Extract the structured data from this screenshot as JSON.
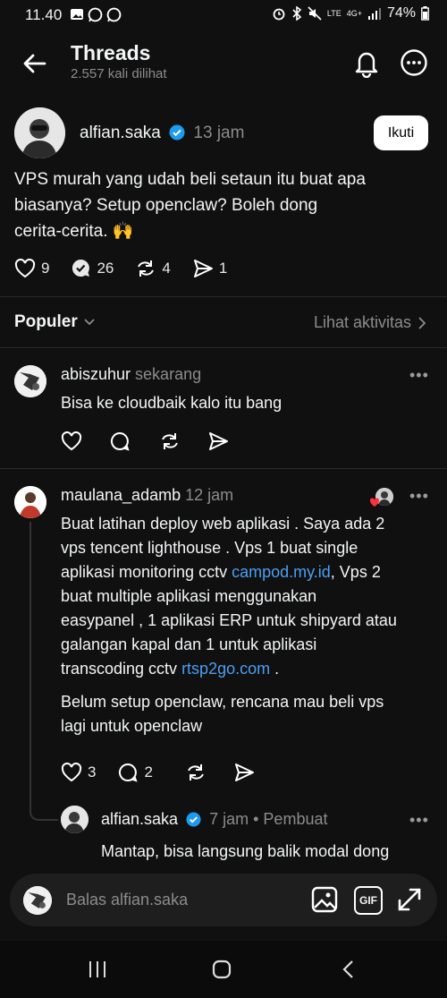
{
  "status": {
    "time": "11.40",
    "battery": "74%",
    "net": "4G+",
    "lte": "LTE"
  },
  "header": {
    "title": "Threads",
    "views": "2.557 kali dilihat"
  },
  "post": {
    "author": "alfian.saka",
    "time": "13 jam",
    "follow_label": "Ikuti",
    "lines": [
      "VPS murah yang udah beli setaun itu buat apa",
      "biasanya? Setup openclaw? Boleh dong",
      "cerita-cerita. 🙌"
    ],
    "likes": "9",
    "comments": "26",
    "reposts": "4",
    "shares": "1"
  },
  "sort": {
    "label": "Populer",
    "activity": "Lihat aktivitas"
  },
  "comments": [
    {
      "author": "abiszuhur",
      "time": "sekarang",
      "text": "Bisa ke cloudbaik kalo itu bang"
    },
    {
      "author": "maulana_adamb",
      "time": "12 jam",
      "p1_l1": "Buat latihan deploy web aplikasi . Saya ada 2",
      "p1_l2": "vps tencent lighthouse . Vps 1 buat single",
      "p1_l3_pre": "aplikasi monitoring cctv ",
      "p1_l3_link": "campod.my.id",
      "p1_l3_post": ", Vps 2",
      "p1_l4": "buat multiple aplikasi menggunakan",
      "p1_l5": "easypanel , 1 aplikasi ERP untuk shipyard atau",
      "p1_l6": "galangan kapal dan 1 untuk aplikasi",
      "p1_l7_pre": "transcoding cctv ",
      "p1_l7_link": "rtsp2go.com",
      "p1_l7_post": " .",
      "p2_l1": "Belum setup openclaw, rencana mau beli vps",
      "p2_l2": "lagi untuk openclaw",
      "likes": "3",
      "comments": "2"
    }
  ],
  "reply": {
    "author": "alfian.saka",
    "time": "7 jam",
    "badge": "• Pembuat",
    "text": "Mantap, bisa langsung balik modal dong"
  },
  "composer": {
    "placeholder": "Balas alfian.saka",
    "gif": "GIF"
  }
}
